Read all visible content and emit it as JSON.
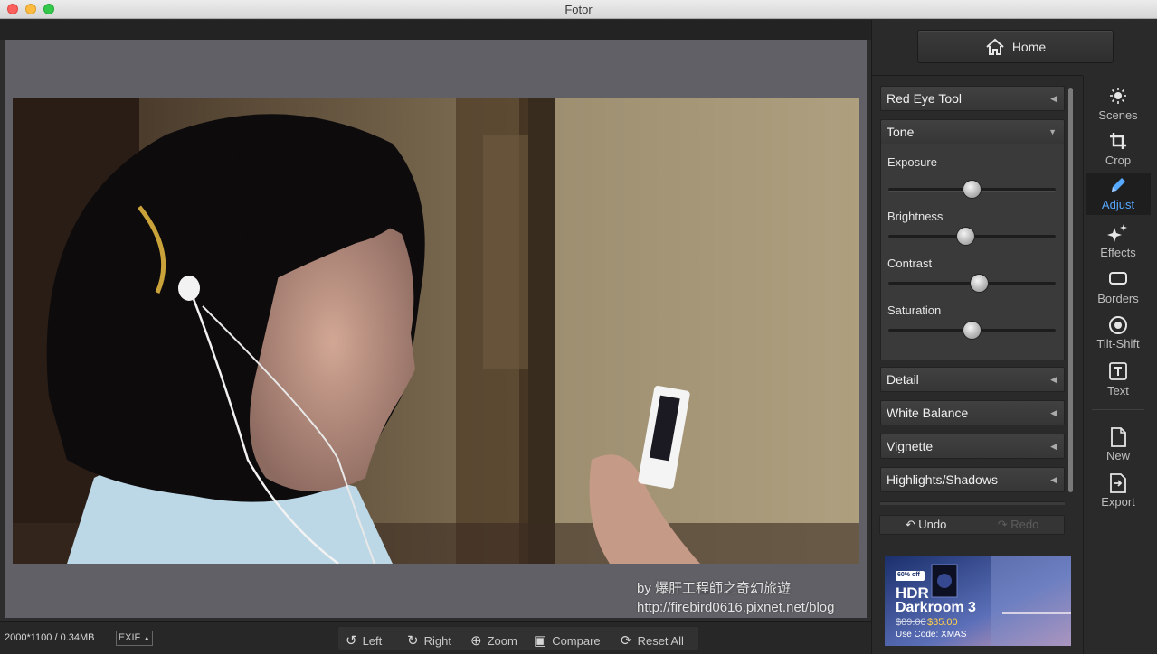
{
  "window": {
    "title": "Fotor"
  },
  "home_button": {
    "label": "Home"
  },
  "adjust_sections": [
    {
      "label": "Red Eye Tool"
    },
    {
      "label": "Tone"
    },
    {
      "label": "Detail"
    },
    {
      "label": "White Balance"
    },
    {
      "label": "Vignette"
    },
    {
      "label": "Highlights/Shadows"
    }
  ],
  "tone": {
    "exposure_label": "Exposure",
    "brightness_label": "Brightness",
    "contrast_label": "Contrast",
    "saturation_label": "Saturation",
    "exposure_value": 0.5,
    "brightness_value": 0.46,
    "contrast_value": 0.55,
    "saturation_value": 0.5
  },
  "history": {
    "undo_label": "Undo",
    "redo_label": "Redo"
  },
  "tools": {
    "scenes": "Scenes",
    "crop": "Crop",
    "adjust": "Adjust",
    "effects": "Effects",
    "borders": "Borders",
    "tilt_shift": "Tilt-Shift",
    "text": "Text",
    "new": "New",
    "export": "Export"
  },
  "status": {
    "dimensions": "2000*1100 / 0.34MB",
    "exif_label": "EXIF"
  },
  "bottom_tools": {
    "left": "Left",
    "right": "Right",
    "zoom": "Zoom",
    "compare": "Compare",
    "reset_all": "Reset All"
  },
  "watermark": {
    "line1": "by 爆肝工程師之奇幻旅遊",
    "line2": "http://firebird0616.pixnet.net/blog"
  },
  "ad": {
    "badge": "60% off",
    "title1": "HDR",
    "title2": "Darkroom 3",
    "old_price": "$89.00",
    "new_price": "$35.00",
    "code": "Use Code: XMAS"
  },
  "colors": {
    "accent": "#57a8ff",
    "panel": "#2a2a2a",
    "canvas": "#606066"
  }
}
